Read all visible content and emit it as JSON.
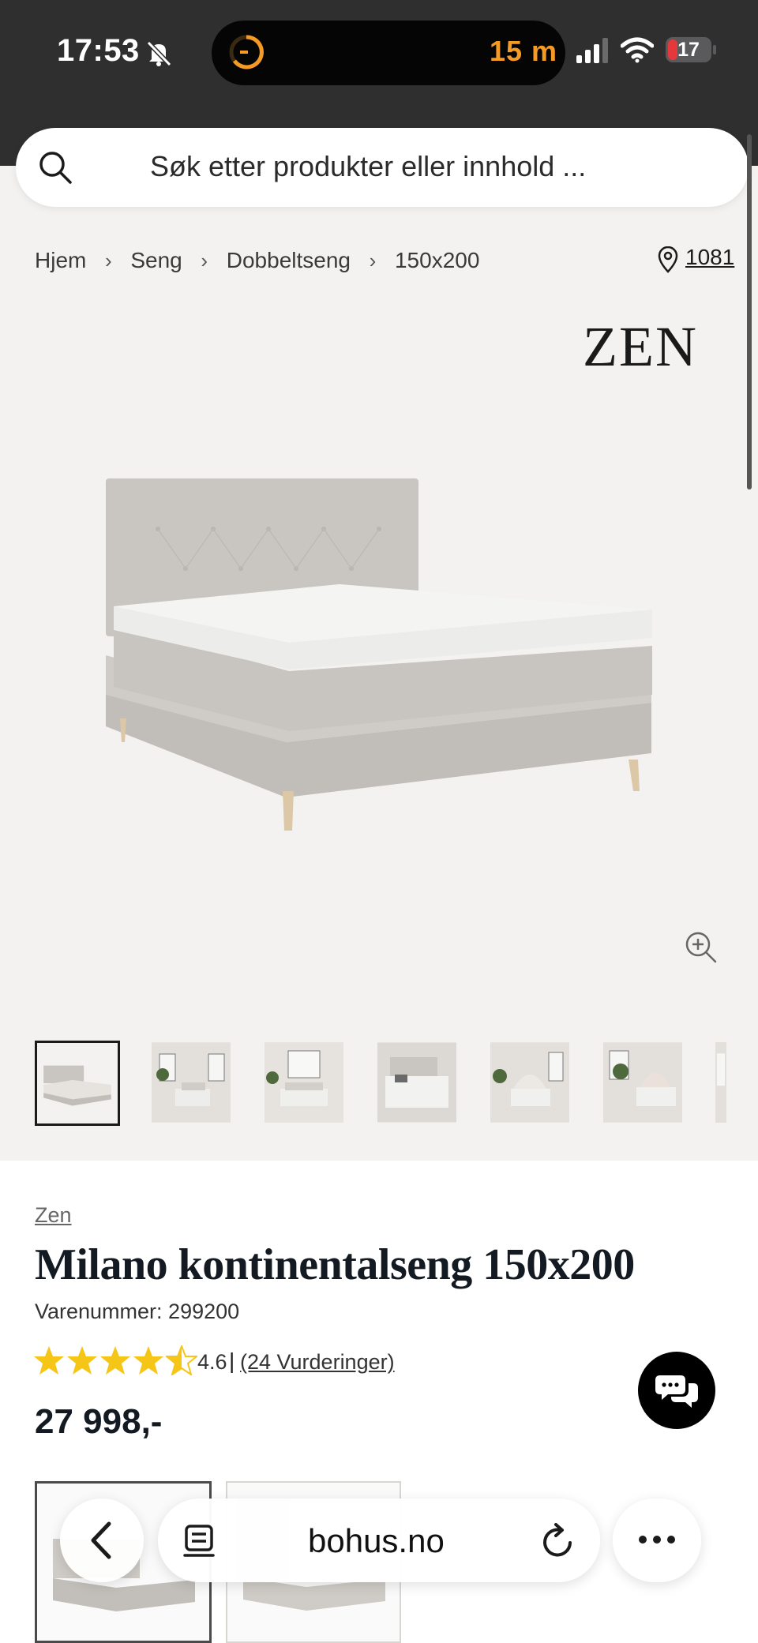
{
  "status_bar": {
    "time": "17:53",
    "island_timer_text": "15 m",
    "battery_level": "17",
    "icons": [
      "bell-slash-icon",
      "timer-icon",
      "signal-icon",
      "wifi-icon",
      "battery-icon"
    ]
  },
  "search": {
    "placeholder": "Søk etter produkter eller innhold ..."
  },
  "breadcrumb": {
    "items": [
      "Hjem",
      "Seng",
      "Dobbeltseng",
      "150x200"
    ]
  },
  "store": {
    "code": "1081"
  },
  "product": {
    "brand_logo": "ZEN",
    "brand_link": "Zen",
    "title": "Milano kontinentalseng 150x200",
    "sku_label": "Varenummer: 299200",
    "rating": 4.6,
    "rating_label": "4.6",
    "reviews_link": "(24 Vurderinger)",
    "price": "27 998,-",
    "thumbnail_count_visible": 7,
    "selected_thumbnail": 0
  },
  "browser": {
    "url": "bohus.no"
  },
  "colors": {
    "page_bg": "#f4f2f0",
    "status_bg": "#2f2f30",
    "timer_accent": "#f59a23",
    "battery_red": "#e5383b",
    "star_yellow": "#f5c518",
    "title_ink": "#141a22"
  }
}
